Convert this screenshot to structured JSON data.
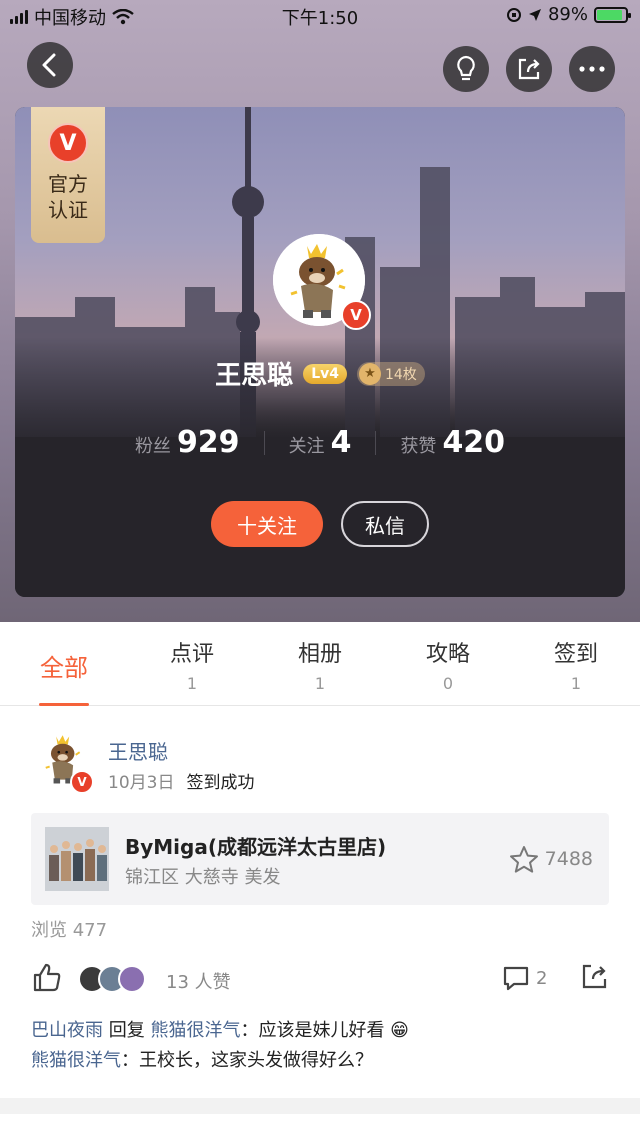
{
  "status_bar": {
    "carrier": "中国移动",
    "time": "下午1:50",
    "battery": "89%",
    "battery_level": 0.89
  },
  "profile": {
    "official_badge_v": "V",
    "official_badge_text": "官方\n认证",
    "avatar_v": "V",
    "name": "王思聪",
    "level": "Lv4",
    "medal_count": "14枚",
    "stats": [
      {
        "label": "粉丝",
        "value": "929"
      },
      {
        "label": "关注",
        "value": "4"
      },
      {
        "label": "获赞",
        "value": "420"
      }
    ],
    "follow_label": "十关注",
    "message_label": "私信"
  },
  "tabs": [
    {
      "label": "全部",
      "count": ""
    },
    {
      "label": "点评",
      "count": "1"
    },
    {
      "label": "相册",
      "count": "1"
    },
    {
      "label": "攻略",
      "count": "0"
    },
    {
      "label": "签到",
      "count": "1"
    }
  ],
  "post": {
    "author": "王思聪",
    "avatar_v": "V",
    "date": "10月3日",
    "action": "签到成功",
    "shop": {
      "title": "ByMiga(成都远洋太古里店)",
      "subtitle": "锦江区 大慈寺 美发",
      "favorites": "7488"
    },
    "views": "浏览 477",
    "likes": "13 人赞",
    "comments_count": "2",
    "comments": [
      {
        "user": "巴山夜雨",
        "reply_word": " 回复 ",
        "target": "熊猫很洋气",
        "text": "：应该是妹儿好看 😁"
      },
      {
        "user": "熊猫很洋气",
        "text": "：王校长，这家头发做得好么？"
      }
    ]
  },
  "colors": {
    "accent": "#f5623a",
    "verified_red": "#e8402a",
    "link_blue": "#4a6690",
    "level_gold": "#e5a92c"
  }
}
